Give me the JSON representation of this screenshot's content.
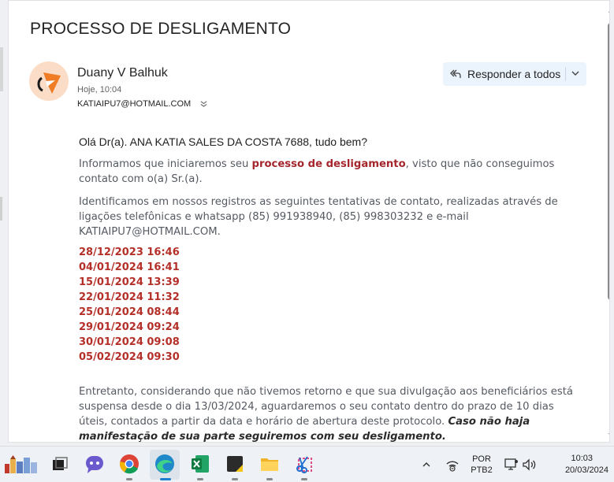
{
  "email": {
    "subject": "PROCESSO DE DESLIGAMENTO",
    "sender": "Duany V Balhuk",
    "time": "Hoje, 10:04",
    "to": "KATIAIPU7@HOTMAIL.COM",
    "reply_all_label": "Responder a todos",
    "greeting": "Olá Dr(a). ANA KATIA SALES DA COSTA 7688, tudo bem?",
    "p1_pre": "Informamos que iniciaremos seu ",
    "p1_highlight": "processo de desligamento",
    "p1_post": ", visto que não conseguimos contato com o(a) Sr.(a).",
    "p2": "Identificamos em nossos registros as seguintes tentativas de contato, realizadas através de ligações telefônicas e whatsapp (85) 991938940, (85) 998303232 e e-mail KATIAIPU7@HOTMAIL.COM.",
    "dates": [
      "28/12/2023 16:46",
      "04/01/2024 16:41",
      "15/01/2024 13:39",
      "22/01/2024 11:32",
      "25/01/2024 08:44",
      "29/01/2024 09:24",
      "30/01/2024 09:08",
      "05/02/2024 09:30"
    ],
    "p3_pre": "Entretanto, considerando que não tivemos retorno e que sua divulgação aos beneficiários está suspensa desde o dia 13/03/2024, aguardaremos o seu contato dentro do prazo de 10 dias úteis, contados a partir da data e horário de abertura deste protocolo. ",
    "p3_em": "Caso não haja manifestação de sua parte seguiremos com seu desligamento."
  },
  "taskbar": {
    "language_line1": "POR",
    "language_line2": "PTB2",
    "clock_time": "10:03",
    "clock_date": "20/03/2024",
    "apps": [
      "widgets-icon",
      "task-view-icon",
      "teams-chat-icon",
      "chrome-icon",
      "edge-icon",
      "excel-icon",
      "sticky-notes-icon",
      "file-explorer-icon",
      "snipping-tool-icon"
    ]
  },
  "colors": {
    "accent_red": "#b42f28",
    "reply_button_bg": "#ebf3fc",
    "avatar_bg": "#fbdcc6"
  }
}
